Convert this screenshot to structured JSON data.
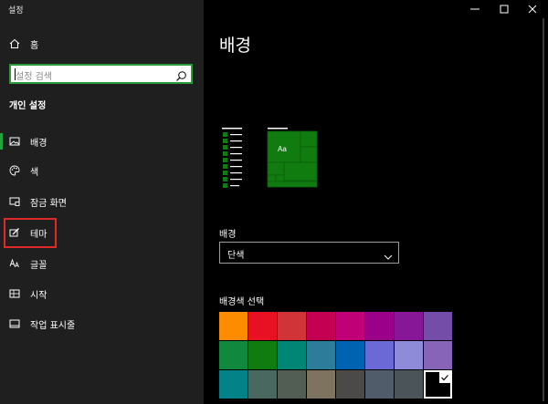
{
  "window": {
    "title": "설정",
    "controls": [
      "minimize-icon",
      "maximize-icon",
      "close-icon"
    ]
  },
  "sidebar": {
    "home_label": "홈",
    "search_placeholder": "설정 검색",
    "section_title": "개인 설정",
    "items": [
      {
        "label": "배경",
        "icon": "picture-icon",
        "active": true
      },
      {
        "label": "색",
        "icon": "palette-icon",
        "active": false
      },
      {
        "label": "잠금 화면",
        "icon": "lock-screen-icon",
        "active": false
      },
      {
        "label": "테마",
        "icon": "theme-brush-icon",
        "active": false,
        "highlighted": true
      },
      {
        "label": "글꼴",
        "icon": "font-icon",
        "active": false
      },
      {
        "label": "시작",
        "icon": "start-icon",
        "active": false
      },
      {
        "label": "작업 표시줄",
        "icon": "taskbar-icon",
        "active": false
      }
    ]
  },
  "main": {
    "title": "배경",
    "preview_tile_text": "Aa",
    "background_label": "배경",
    "background_value": "단색",
    "color_label": "배경색 선택",
    "colors": [
      [
        "#ff8c00",
        "#e81123",
        "#d13438",
        "#c30052",
        "#bf0077",
        "#9a0089",
        "#881798",
        "#744da9"
      ],
      [
        "#10893e",
        "#107c10",
        "#018574",
        "#2d7d9a",
        "#0063b1",
        "#6b69d6",
        "#8e8cd8",
        "#8764b8"
      ],
      [
        "#038387",
        "#486860",
        "#525e54",
        "#7e735f",
        "#4c4a48",
        "#515c6b",
        "#4a5459",
        "#000000"
      ]
    ],
    "selected_color": "#000000"
  },
  "accent_color": "#22a340",
  "preview_color": "#107c10"
}
